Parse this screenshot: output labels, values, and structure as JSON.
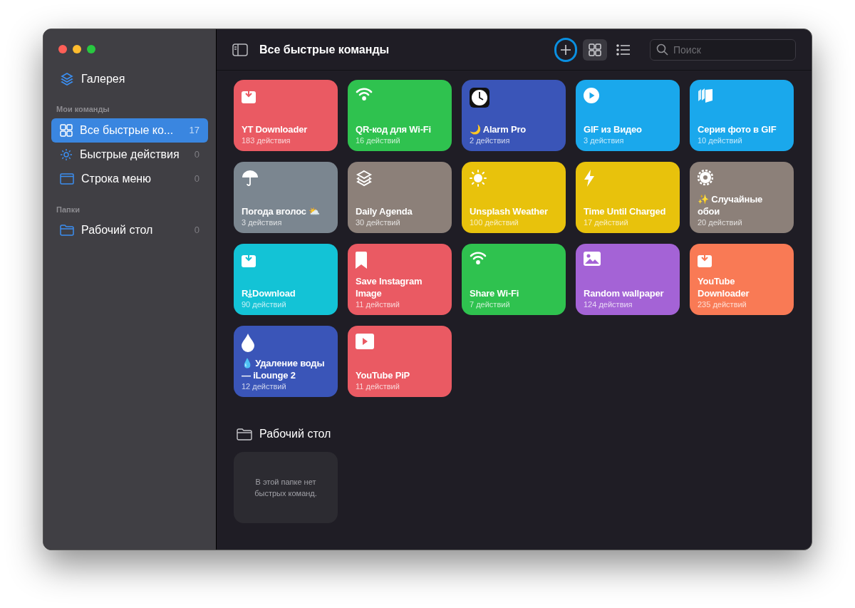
{
  "sidebar": {
    "gallery": {
      "label": "Галерея",
      "kind": "layers"
    },
    "sections": [
      {
        "title": "Мои команды",
        "items": [
          {
            "label": "Все быстрые ко...",
            "count": "17",
            "kind": "grid",
            "selected": true
          },
          {
            "label": "Быстрые действия",
            "count": "0",
            "kind": "gear",
            "selected": false
          },
          {
            "label": "Строка меню",
            "count": "0",
            "kind": "window",
            "selected": false
          }
        ]
      },
      {
        "title": "Папки",
        "items": [
          {
            "label": "Рабочий стол",
            "count": "0",
            "kind": "folder",
            "selected": false
          }
        ]
      }
    ]
  },
  "toolbar": {
    "title": "Все быстрые команды",
    "views": [
      {
        "kind": "grid",
        "selected": true
      },
      {
        "kind": "list",
        "selected": false
      }
    ],
    "search": {
      "placeholder": "Поиск"
    }
  },
  "shortcuts": [
    {
      "title": "YT Downloader",
      "subtitle": "183 действия",
      "color": "#ea5a63",
      "kind": "download"
    },
    {
      "title": "QR-код для Wi-Fi",
      "subtitle": "16 действий",
      "color": "#2fc24f",
      "kind": "wifi"
    },
    {
      "title": "🌙 Alarm Pro",
      "subtitle": "2 действия",
      "color": "#3a55b8",
      "kind": "clock"
    },
    {
      "title": "GIF из Видео",
      "subtitle": "3 действия",
      "color": "#1aa8ec",
      "kind": "play"
    },
    {
      "title": "Серия фото в GIF",
      "subtitle": "10 действий",
      "color": "#1aa8ec",
      "kind": "photos"
    },
    {
      "title": "Погода вголос ⛅",
      "subtitle": "3 действия",
      "color": "#7b8690",
      "kind": "umbrella"
    },
    {
      "title": "Daily Agenda",
      "subtitle": "30 действий",
      "color": "#8c8079",
      "kind": "layers"
    },
    {
      "title": "Unsplash Weather",
      "subtitle": "100 действий",
      "color": "#e8c20c",
      "kind": "sun"
    },
    {
      "title": "Time Until Charged",
      "subtitle": "17 действий",
      "color": "#e8c20c",
      "kind": "bolt"
    },
    {
      "title": "✨ Случайные обои",
      "subtitle": "20 действий",
      "color": "#8c8079",
      "kind": "gear"
    },
    {
      "title": "R⤓Download",
      "subtitle": "90 действий",
      "color": "#13c3d6",
      "kind": "download"
    },
    {
      "title": "Save Instagram Image",
      "subtitle": "11 действий",
      "color": "#ea5a63",
      "kind": "bookmark"
    },
    {
      "title": "Share Wi-Fi",
      "subtitle": "7 действий",
      "color": "#2fc24f",
      "kind": "wifi"
    },
    {
      "title": "Random wallpaper",
      "subtitle": "124 действия",
      "color": "#a463d6",
      "kind": "image"
    },
    {
      "title": "YouTube Downloader",
      "subtitle": "235 действий",
      "color": "#f97a55",
      "kind": "download"
    },
    {
      "title": "💧 Удаление воды — iLounge 2",
      "subtitle": "12 действий",
      "color": "#3a55b8",
      "kind": "drop"
    },
    {
      "title": "YouTube PiP",
      "subtitle": "11 действий",
      "color": "#ea5a63",
      "kind": "video"
    }
  ],
  "folder": {
    "title": "Рабочий стол",
    "empty_text": "В этой папке нет быстрых команд."
  }
}
